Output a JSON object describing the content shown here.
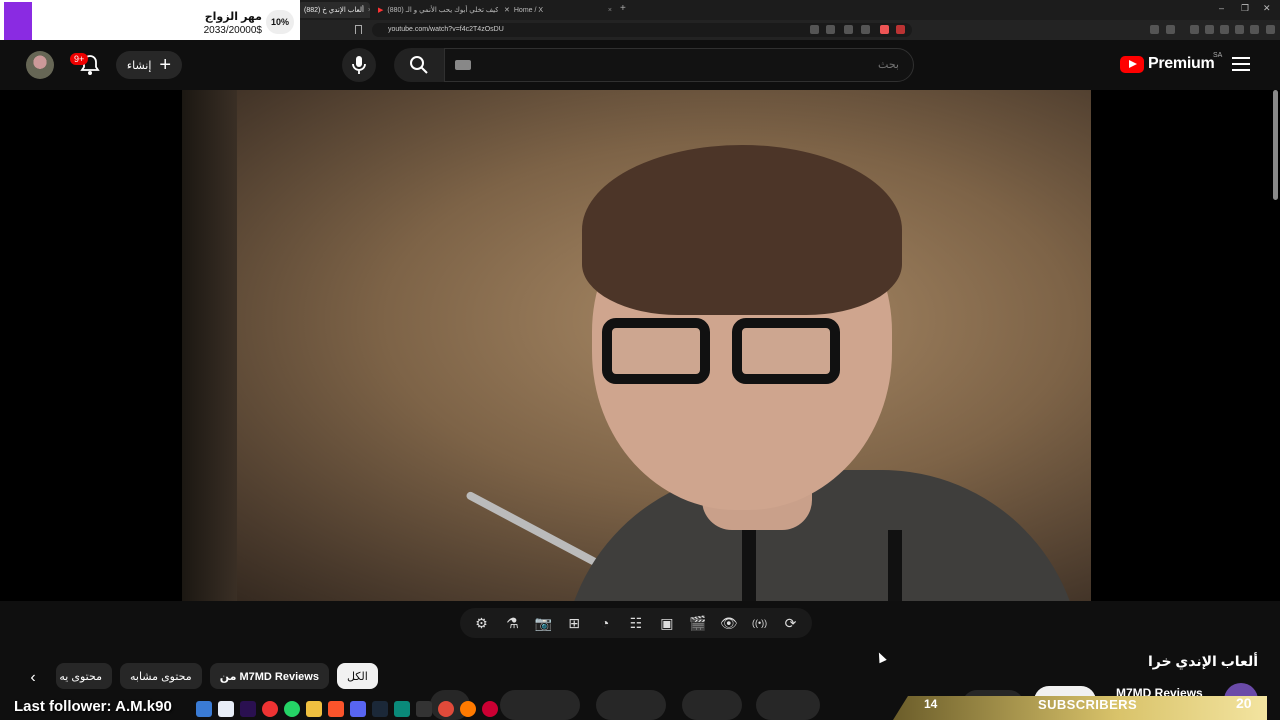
{
  "browser": {
    "tabs": [
      {
        "label": "(882) ألعاب الإندي خ"
      },
      {
        "label": "(880) كيف تخلي أبوك يحب الأنمي و الـ"
      },
      {
        "label": "Home / X"
      }
    ],
    "url": "youtube.com/watch?v=f4c2T4zOsDU"
  },
  "overlay": {
    "goal_title": "مهر الزواج",
    "goal_amount": "2033/20000$",
    "goal_percent": "10%",
    "last_follower": "Last follower: A.M.k90",
    "subs_count": "14",
    "subs_label": "SUBSCRIBERS",
    "subs_goal": "20",
    "goal_color": "#8a2be2"
  },
  "header": {
    "notification_count": "9+",
    "create_label": "إنشاء",
    "search_placeholder": "بحث",
    "logo_text": "Premium",
    "region": "SA",
    "brand_color": "#ff0000"
  },
  "player_controls": [
    {
      "icon": "settings-icon",
      "glyph": "⚙"
    },
    {
      "icon": "flask-icon",
      "glyph": "⚗"
    },
    {
      "icon": "camera-icon",
      "glyph": "📷"
    },
    {
      "icon": "add-frame-icon",
      "glyph": "⊞"
    },
    {
      "icon": "speed-icon",
      "glyph": "◔"
    },
    {
      "icon": "subtitles-icon",
      "glyph": "☷"
    },
    {
      "icon": "picture-in-picture-icon",
      "glyph": "▣"
    },
    {
      "icon": "clapperboard-icon",
      "glyph": "🎬"
    },
    {
      "icon": "eye-icon",
      "glyph": "👁"
    },
    {
      "icon": "broadcast-icon",
      "glyph": "((•))"
    },
    {
      "icon": "loop-icon",
      "glyph": "⟳"
    }
  ],
  "below_video": {
    "title": "ألعاب الإندي خرا",
    "channel": "M7MD Reviews",
    "chips": [
      {
        "label": "الكل",
        "active": true
      },
      {
        "label": "من M7MD Reviews",
        "active": false
      },
      {
        "label": "محتوى مشابه",
        "active": false
      },
      {
        "label": "محتوى يه",
        "active": false
      }
    ]
  }
}
